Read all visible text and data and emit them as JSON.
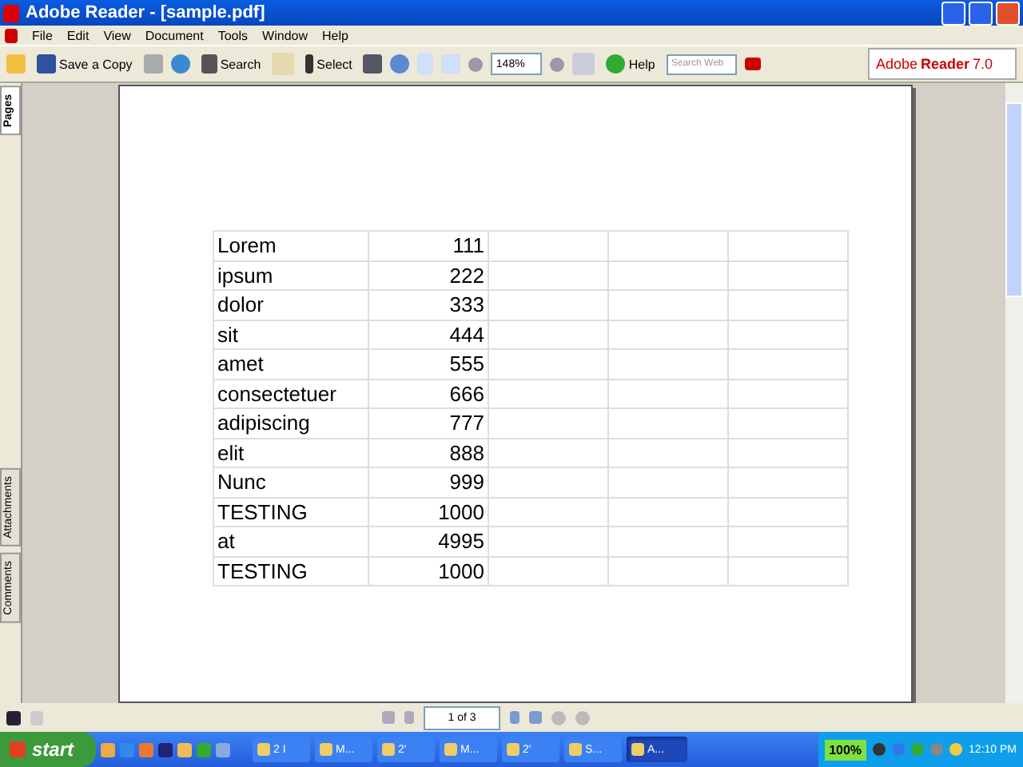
{
  "window": {
    "title": "Adobe Reader - [sample.pdf]"
  },
  "menu": [
    "File",
    "Edit",
    "View",
    "Document",
    "Tools",
    "Window",
    "Help"
  ],
  "toolbar": {
    "save": "Save a Copy",
    "search": "Search",
    "select": "Select",
    "zoom": "148%",
    "help": "Help",
    "search_web": {
      "placeholder": "Search Web"
    },
    "logo": {
      "brand": "Adobe",
      "product": "Reader",
      "version": "7.0"
    }
  },
  "side_tabs": [
    {
      "label": "Pages",
      "selected": true
    },
    {
      "label": "Attachments",
      "selected": false
    },
    {
      "label": "Comments",
      "selected": false
    }
  ],
  "table": {
    "rows": [
      [
        "Lorem",
        "111"
      ],
      [
        "ipsum",
        "222"
      ],
      [
        "dolor",
        "333"
      ],
      [
        "sit",
        "444"
      ],
      [
        "amet",
        "555"
      ],
      [
        "consectetuer",
        "666"
      ],
      [
        "adipiscing",
        "777"
      ],
      [
        "elit",
        "888"
      ],
      [
        "Nunc",
        "999"
      ],
      [
        "TESTING",
        "1000"
      ],
      [
        "at",
        "4995"
      ],
      [
        "TESTING",
        "1000"
      ]
    ]
  },
  "page_nav": {
    "value": "1 of 3"
  },
  "taskbar": {
    "start": "start",
    "buttons": [
      {
        "label": "2 I",
        "selected": false
      },
      {
        "label": "M...",
        "selected": false
      },
      {
        "label": "2'",
        "selected": false
      },
      {
        "label": "M...",
        "selected": false
      },
      {
        "label": "2'",
        "selected": false
      },
      {
        "label": "S...",
        "selected": false
      },
      {
        "label": "A...",
        "selected": true
      }
    ],
    "battery": "100%",
    "clock": "12:10 PM"
  }
}
